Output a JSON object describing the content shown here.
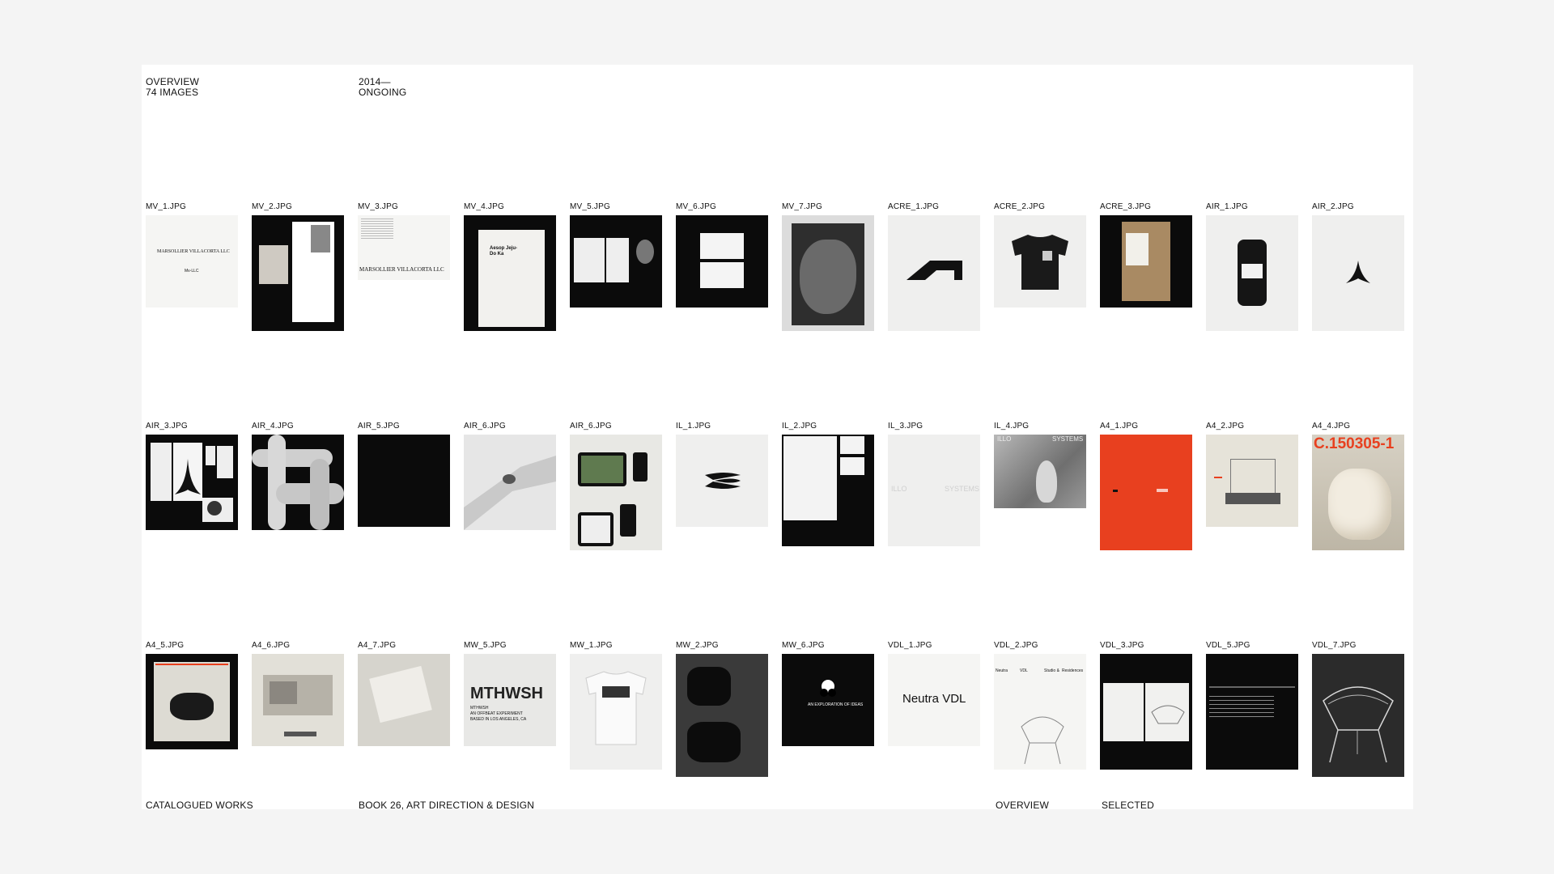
{
  "header": {
    "overview_line1": "OVERVIEW",
    "overview_line2": "74 IMAGES",
    "years_line1": "2014—",
    "years_line2": "ONGOING"
  },
  "grid": {
    "row1": [
      "MV_1.JPG",
      "MV_2.JPG",
      "MV_3.JPG",
      "MV_4.JPG",
      "MV_5.JPG",
      "MV_6.JPG",
      "MV_7.JPG",
      "ACRE_1.JPG",
      "ACRE_2.JPG",
      "ACRE_3.JPG",
      "AIR_1.JPG",
      "AIR_2.JPG"
    ],
    "row2": [
      "AIR_3.JPG",
      "AIR_4.JPG",
      "AIR_5.JPG",
      "AIR_6.JPG",
      "AIR_6.JPG",
      "IL_1.JPG",
      "IL_2.JPG",
      "IL_3.JPG",
      "IL_4.JPG",
      "A4_1.JPG",
      "A4_2.JPG",
      "A4_4.JPG"
    ],
    "row3": [
      "A4_5.JPG",
      "A4_6.JPG",
      "A4_7.JPG",
      "MW_5.JPG",
      "MW_1.JPG",
      "MW_2.JPG",
      "MW_6.JPG",
      "VDL_1.JPG",
      "VDL_2.JPG",
      "VDL_3.JPG",
      "VDL_5.JPG",
      "VDL_7.JPG"
    ]
  },
  "thumb_text": {
    "mv1_name": "MARSOLLIER VILLACORTA LLC",
    "mv1_mark": "Mv-LLC",
    "mv3_name": "MARSOLLIER VILLACORTA LLC",
    "mv4_title": "Aesop Jeju-Do Ka",
    "a4_4_code": "C.150305-1",
    "il4_left": "ILLO",
    "il4_right": "SYSTEMS",
    "il3_left": "ILLO",
    "il3_right": "SYSTEMS",
    "mw5_word": "MTHWSH",
    "mw5_line1": "MTHWSH",
    "mw5_line2": "AN OFFBEAT EXPERIMENT",
    "mw5_line3": "BASED IN LOS ANGELES, CA",
    "vdl1_title": "Neutra VDL",
    "vdl2_c1": "Neutra",
    "vdl2_c2": "VDL",
    "vdl2_c3": "Studio &",
    "vdl2_c4": "Residences",
    "mw6_line": "AN EXPLORATION OF IDEAS"
  },
  "footer": {
    "left": "CATALOGUED WORKS",
    "middle": "BOOK 26, ART DIRECTION & DESIGN",
    "right1": "OVERVIEW",
    "right2": "SELECTED"
  },
  "colors": {
    "background": "#f4f4f4",
    "page": "#ffffff",
    "accent_red": "#e8401f"
  }
}
